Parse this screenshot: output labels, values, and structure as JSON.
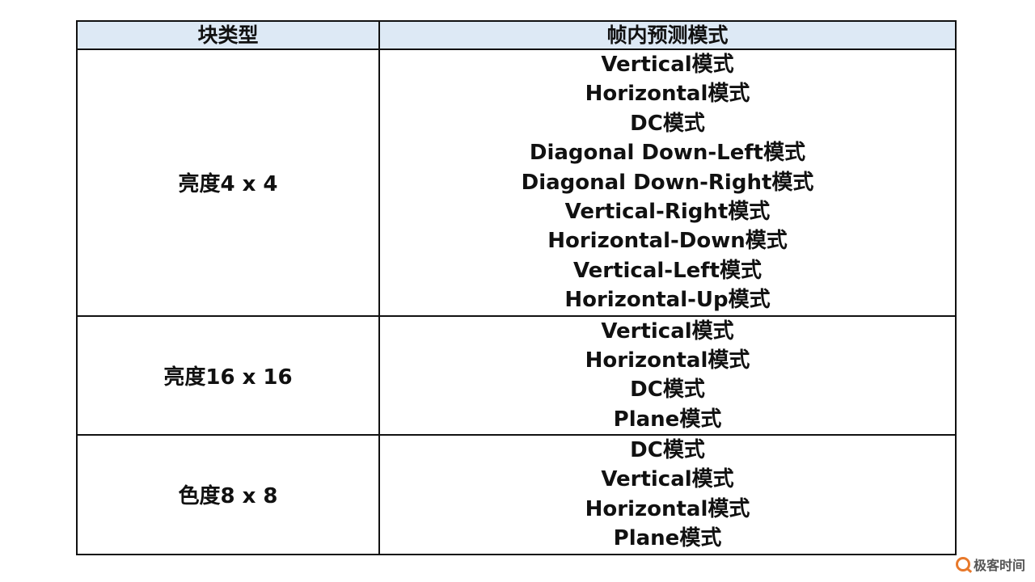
{
  "table": {
    "headers": [
      "块类型",
      "帧内预测模式"
    ],
    "rows": [
      {
        "type": "亮度4 x 4",
        "modes": [
          "Vertical模式",
          "Horizontal模式",
          "DC模式",
          "Diagonal Down-Left模式",
          "Diagonal Down-Right模式",
          "Vertical-Right模式",
          "Horizontal-Down模式",
          "Vertical-Left模式",
          "Horizontal-Up模式"
        ]
      },
      {
        "type": "亮度16 x 16",
        "modes": [
          "Vertical模式",
          "Horizontal模式",
          "DC模式",
          "Plane模式"
        ]
      },
      {
        "type": "色度8 x 8",
        "modes": [
          "DC模式",
          "Vertical模式",
          "Horizontal模式",
          "Plane模式"
        ]
      }
    ]
  },
  "watermark": {
    "text": "极客时间",
    "logo_icon": "geektime-logo-icon",
    "logo_color": "#e8792b"
  },
  "colors": {
    "header_bg": "#dde9f5",
    "border": "#111111"
  }
}
